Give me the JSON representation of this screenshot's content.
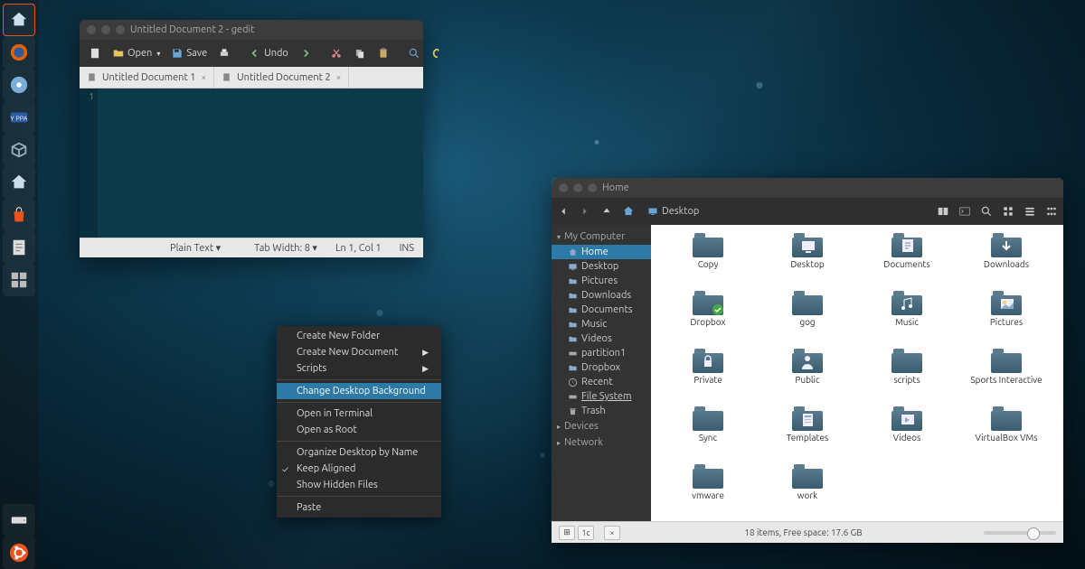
{
  "launcher": [
    {
      "name": "files-shortcut",
      "glyph": "home"
    },
    {
      "name": "firefox",
      "glyph": "firefox"
    },
    {
      "name": "disc-app",
      "glyph": "disc"
    },
    {
      "name": "yppa",
      "glyph": "yppa"
    },
    {
      "name": "virtualbox",
      "glyph": "vbox"
    },
    {
      "name": "home-alt",
      "glyph": "home"
    },
    {
      "name": "software-center",
      "glyph": "bag"
    },
    {
      "name": "text-editor",
      "glyph": "note"
    },
    {
      "name": "workspace-switcher",
      "glyph": "grid"
    }
  ],
  "launcher_bottom": [
    {
      "name": "drive",
      "glyph": "drive"
    },
    {
      "name": "ubuntu-dash",
      "glyph": "ubuntu"
    }
  ],
  "gedit": {
    "title": "Untitled Document 2 - gedit",
    "toolbar": {
      "open": "Open",
      "save": "Save",
      "undo": "Undo"
    },
    "tabs": [
      {
        "label": "Untitled Document 1"
      },
      {
        "label": "Untitled Document 2"
      }
    ],
    "line_no": "1",
    "status": {
      "syntax": "Plain Text ▾",
      "tabwidth": "Tab Width: 8 ▾",
      "pos": "Ln 1, Col 1",
      "mode": "INS"
    }
  },
  "context_menu": {
    "items": [
      {
        "label": "Create New Folder"
      },
      {
        "label": "Create New Document",
        "sub": true
      },
      {
        "label": "Scripts",
        "sub": true
      },
      {
        "sep": true
      },
      {
        "label": "Change Desktop Background",
        "hl": true
      },
      {
        "sep": true
      },
      {
        "label": "Open in Terminal"
      },
      {
        "label": "Open as Root"
      },
      {
        "sep": true
      },
      {
        "label": "Organize Desktop by Name"
      },
      {
        "label": "Keep Aligned",
        "chk": true
      },
      {
        "label": "Show Hidden Files"
      },
      {
        "sep": true
      },
      {
        "label": "Paste"
      }
    ]
  },
  "fm": {
    "title": "Home",
    "path_label": "Desktop",
    "sidebar": {
      "sections": [
        {
          "label": "My Computer",
          "items": [
            {
              "label": "Home",
              "icon": "home",
              "sel": true
            },
            {
              "label": "Desktop",
              "icon": "desktop"
            },
            {
              "label": "Pictures",
              "icon": "folder"
            },
            {
              "label": "Downloads",
              "icon": "folder"
            },
            {
              "label": "Documents",
              "icon": "folder"
            },
            {
              "label": "Music",
              "icon": "folder"
            },
            {
              "label": "Videos",
              "icon": "folder"
            },
            {
              "label": "partition1",
              "icon": "drive"
            },
            {
              "label": "Dropbox",
              "icon": "folder"
            },
            {
              "label": "Recent",
              "icon": "clock"
            },
            {
              "label": "File System",
              "icon": "drive",
              "underline": true
            },
            {
              "label": "Trash",
              "icon": "trash"
            }
          ]
        },
        {
          "label": "Devices",
          "collapsed": true,
          "items": []
        },
        {
          "label": "Network",
          "collapsed": true,
          "items": []
        }
      ]
    },
    "files": [
      "Copy",
      "Desktop",
      "Documents",
      "Downloads",
      "Dropbox",
      "gog",
      "Music",
      "Pictures",
      "Private",
      "Public",
      "scripts",
      "Sports Interactive",
      "Sync",
      "Templates",
      "Videos",
      "VirtualBox VMs",
      "vmware",
      "work"
    ],
    "status": "18 items, Free space: 17.6 GB"
  }
}
